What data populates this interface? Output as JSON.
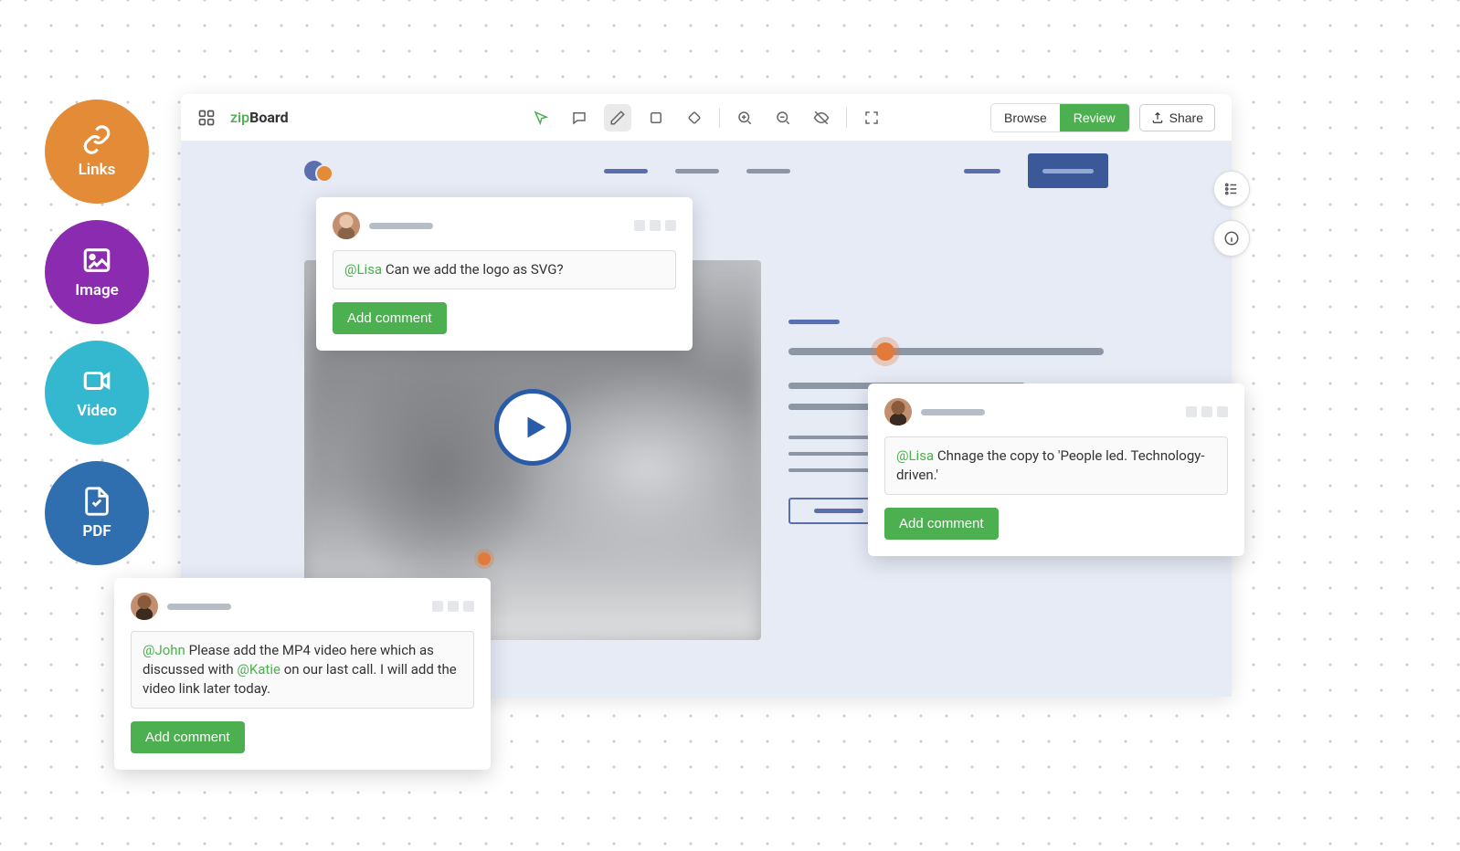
{
  "bubbles": {
    "links": "Links",
    "image": "Image",
    "video": "Video",
    "pdf": "PDF"
  },
  "app": {
    "logo_prefix": "zip",
    "logo_suffix": "Board",
    "toolbar": {
      "browse": "Browse",
      "review": "Review",
      "share": "Share"
    }
  },
  "comments": {
    "c1": {
      "mention": "@Lisa",
      "text": " Can we add the logo as SVG?",
      "button": "Add comment"
    },
    "c2": {
      "mention": "@Lisa",
      "text": " Chnage the copy to 'People led. Technology-driven.'",
      "button": "Add comment"
    },
    "c3": {
      "mention1": "@John",
      "part1": " Please add the MP4 video here which as discussed with ",
      "mention2": "@Katie",
      "part2": " on our last call. I will add the video link later today.",
      "button": "Add comment"
    }
  }
}
